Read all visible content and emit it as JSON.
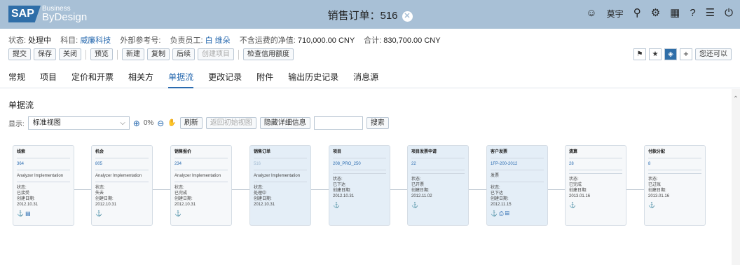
{
  "shell": {
    "logo_main": "SAP",
    "logo_sub_top": "Business",
    "logo_sub_bottom": "ByDesign",
    "title": "销售订单：516",
    "close_glyph": "✕",
    "user": "莫宇",
    "icons": [
      "user-circle-icon",
      "search-icon",
      "gear-icon",
      "calculator-icon",
      "help-icon",
      "list-icon",
      "power-icon"
    ]
  },
  "info": {
    "status_label": "状态:",
    "status_value": "处理中",
    "account_label": "科目:",
    "account_value": "威廉科技",
    "extref_label": "外部参考号:",
    "employee_label": "负责员工:",
    "employee_value": "白 维朵",
    "net_label": "不含运费的净值:",
    "net_value": "710,000.00 CNY",
    "total_label": "合计:",
    "total_value": "830,700.00 CNY"
  },
  "toolbar": {
    "submit": "提交",
    "save": "保存",
    "close": "关闭",
    "preview": "预览",
    "new": "新建",
    "copy": "复制",
    "followup": "后续",
    "create_item": "创建项目",
    "check_credit": "检查信用额度",
    "right_text": "您还可以"
  },
  "tabs": [
    "常规",
    "项目",
    "定价和开票",
    "相关方",
    "单据流",
    "更改记录",
    "附件",
    "输出历史记录",
    "消息源"
  ],
  "section": {
    "title": "单据流",
    "display_label": "显示:",
    "view_value": "标准视图",
    "zoom": "0%",
    "refresh": "刷新",
    "back_to_initial": "返回初始视图",
    "hide_details": "隐藏详细信息",
    "search": "搜索"
  },
  "cards": [
    {
      "title": "线索",
      "id": "364",
      "desc": "Analyzer Implementation",
      "status_label": "状态:",
      "status": "已接受",
      "date_label": "创建日期:",
      "date": "2012.10.31",
      "icons": "⚓ ▤"
    },
    {
      "title": "机会",
      "id": "805",
      "desc": "Analyzer Implementation",
      "status_label": "状态:",
      "status": "失去",
      "date_label": "创建日期:",
      "date": "2012.10.31",
      "icons": "⚓"
    },
    {
      "title": "销售报价",
      "id": "234",
      "desc": "Analyzer Implementation",
      "status_label": "状态:",
      "status": "已完成",
      "date_label": "创建日期:",
      "date": "2012.10.31",
      "icons": "⚓"
    },
    {
      "title": "销售订单",
      "id": "516",
      "desc": "Analyzer Implementation",
      "status_label": "状态:",
      "status": "处理中",
      "date_label": "创建日期:",
      "date": "2012.10.31",
      "icons": ""
    },
    {
      "title": "项目",
      "id": "208_PRO_250",
      "desc": "",
      "status_label": "状态:",
      "status": "已下达",
      "date_label": "创建日期:",
      "date": "2012.10.31",
      "icons": "⚓"
    },
    {
      "title": "项目发票申请",
      "id": "22",
      "desc": "",
      "status_label": "状态:",
      "status": "已开票",
      "date_label": "创建日期:",
      "date": "2012.11.02",
      "icons": "⚓"
    },
    {
      "title": "客户发票",
      "id": "1FP-200-2012",
      "desc": "发票",
      "status_label": "状态:",
      "status": "已下达",
      "date_label": "创建日期:",
      "date": "2012.11.15",
      "icons": "⚓ ⎙ ▤"
    },
    {
      "title": "清算",
      "id": "28",
      "desc": "",
      "status_label": "状态:",
      "status": "已完成",
      "date_label": "创建日期:",
      "date": "2013.01.16",
      "icons": "⚓"
    },
    {
      "title": "付款分配",
      "id": "8",
      "desc": "",
      "status_label": "状态:",
      "status": "已过账",
      "date_label": "创建日期:",
      "date": "2013.01.16",
      "icons": "⚓"
    }
  ]
}
